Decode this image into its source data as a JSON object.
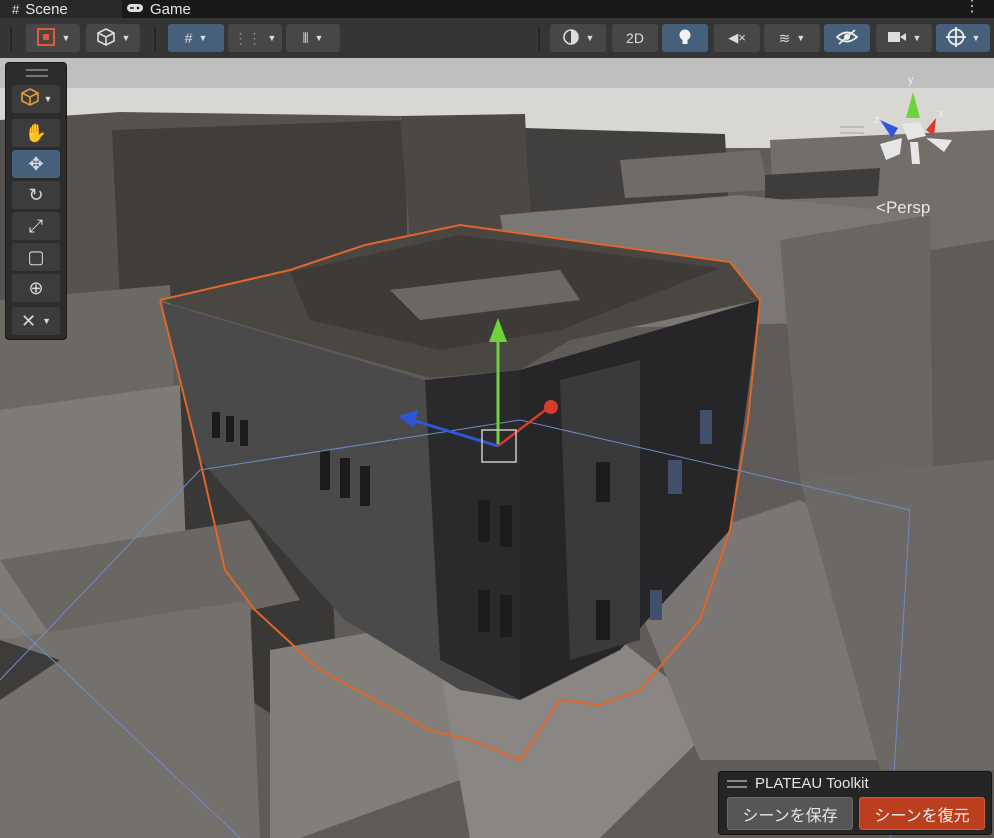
{
  "tabs": [
    {
      "label": "Scene",
      "icon": "grid-icon",
      "active": true
    },
    {
      "label": "Game",
      "icon": "gamepad-icon",
      "active": false
    }
  ],
  "toolbar": {
    "mode_2d_label": "2D"
  },
  "viewport": {
    "projection_label": "Persp",
    "axis_labels": {
      "y": "y",
      "x": "x",
      "z": "z"
    }
  },
  "tools": [
    {
      "name": "view-tool",
      "icon": "hand-icon"
    },
    {
      "name": "move-tool",
      "icon": "move-arrows-icon",
      "active": true
    },
    {
      "name": "rotate-tool",
      "icon": "rotate-icon"
    },
    {
      "name": "scale-tool",
      "icon": "scale-icon"
    },
    {
      "name": "rect-tool",
      "icon": "rect-transform-icon"
    },
    {
      "name": "transform-tool",
      "icon": "transform-icon"
    },
    {
      "name": "custom-tool",
      "icon": "wrench-icon"
    }
  ],
  "plateau_toolkit": {
    "title": "PLATEAU Toolkit",
    "save_label": "シーンを保存",
    "restore_label": "シーンを復元"
  },
  "colors": {
    "selection_outline": "#e0662a",
    "axis_y": "#6cd33a",
    "axis_x": "#d83a2c",
    "axis_z": "#2f56d8",
    "active_button": "#46607c",
    "restore_button": "#bb3f1f"
  }
}
